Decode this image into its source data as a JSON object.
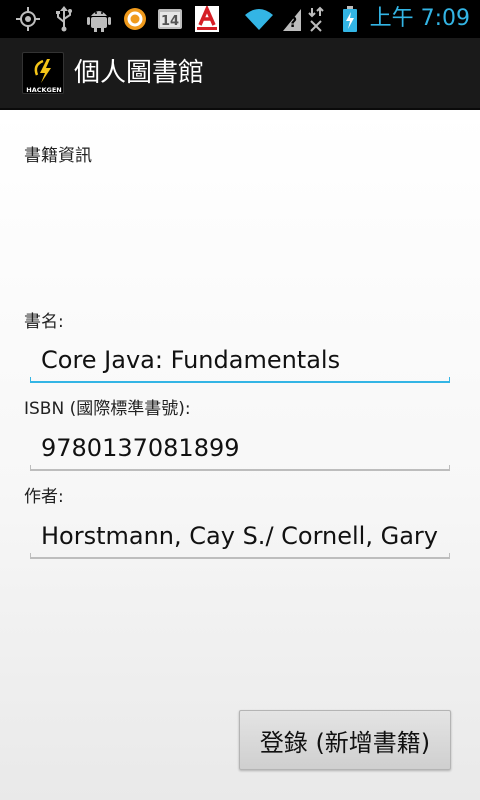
{
  "status_bar": {
    "time": "上午 7:09",
    "notification_badge": "14",
    "icons": [
      "gps-icon",
      "usb-icon",
      "android-debug-icon",
      "sync-icon",
      "calendar-icon",
      "app-a-icon",
      "wifi-icon",
      "unknown-signal-icon",
      "no-data-icon",
      "battery-charging-icon"
    ]
  },
  "action_bar": {
    "title": "個人圖書館",
    "logo_text": "HACKGEN"
  },
  "form": {
    "section_title": "書籍資訊",
    "title_label": "書名:",
    "title_value": "Core Java: Fundamentals",
    "isbn_label": "ISBN (國際標準書號):",
    "isbn_value": "9780137081899",
    "author_label": "作者:",
    "author_value": "Horstmann, Cay S./ Cornell, Gary"
  },
  "buttons": {
    "register_label": "登錄 (新增書籍)"
  },
  "colors": {
    "accent": "#33b5e5",
    "status_bar_bg": "#000000",
    "action_bar_bg": "#1a1a1a",
    "logo_bolt": "#f5c518"
  }
}
